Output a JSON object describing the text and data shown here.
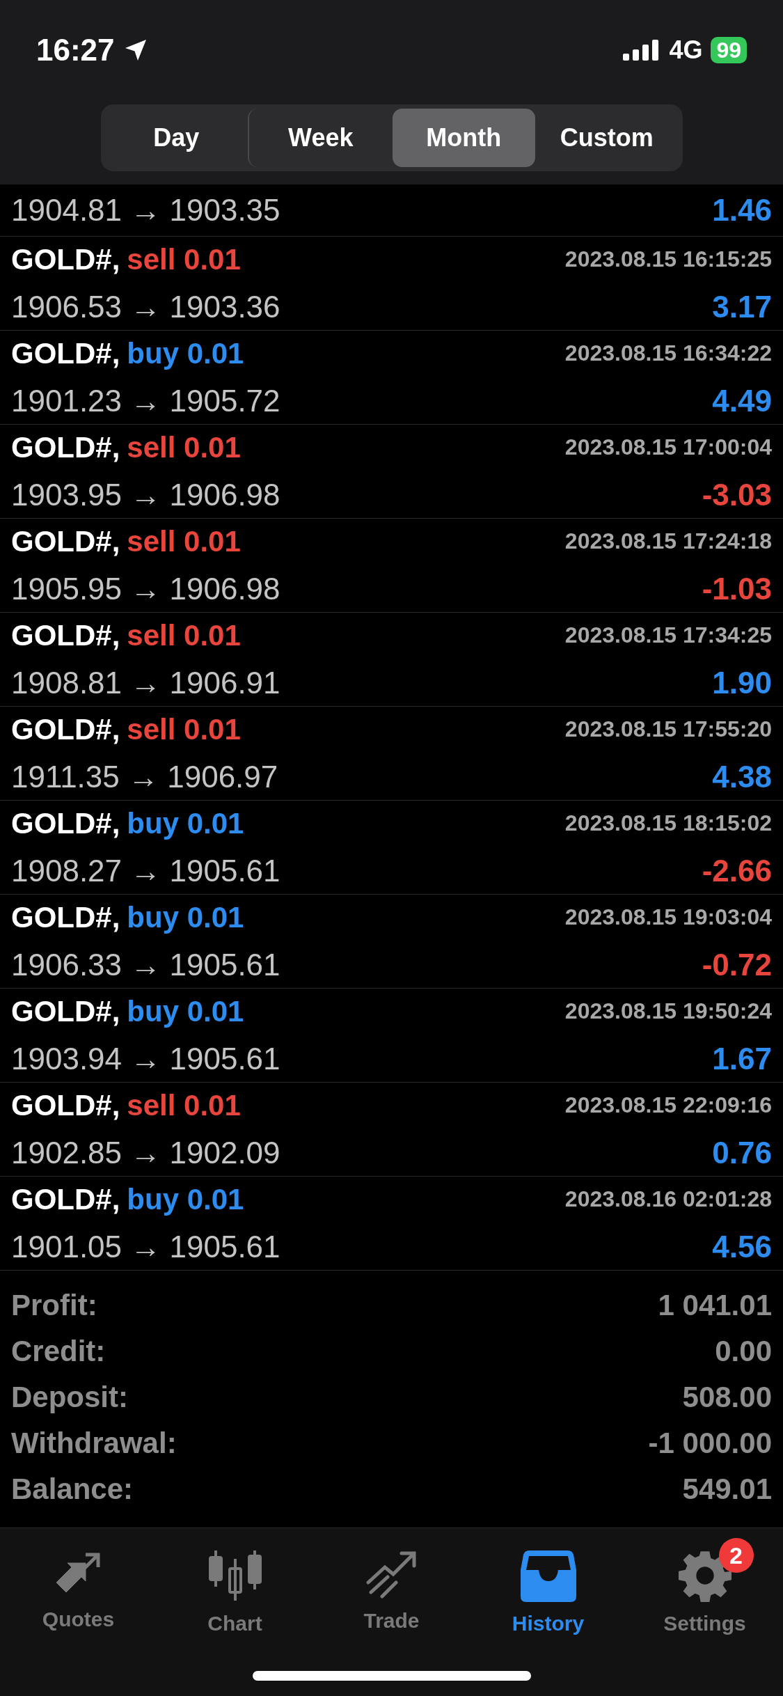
{
  "status_bar": {
    "time": "16:27",
    "network": "4G",
    "battery": "99"
  },
  "periods": [
    {
      "label": "Day",
      "selected": false
    },
    {
      "label": "Week",
      "selected": false
    },
    {
      "label": "Month",
      "selected": true
    },
    {
      "label": "Custom",
      "selected": false
    }
  ],
  "partial_trade": {
    "prices": "1904.81 → 1903.35",
    "profit": "1.46",
    "loss": false
  },
  "trades": [
    {
      "symbol": "GOLD#,",
      "kind": "sell",
      "order": "sell 0.01",
      "time": "2023.08.15 16:15:25",
      "prices": "1906.53 → 1903.36",
      "profit": "3.17",
      "loss": false
    },
    {
      "symbol": "GOLD#,",
      "kind": "buy",
      "order": "buy 0.01",
      "time": "2023.08.15 16:34:22",
      "prices": "1901.23 → 1905.72",
      "profit": "4.49",
      "loss": false
    },
    {
      "symbol": "GOLD#,",
      "kind": "sell",
      "order": "sell 0.01",
      "time": "2023.08.15 17:00:04",
      "prices": "1903.95 → 1906.98",
      "profit": "-3.03",
      "loss": true
    },
    {
      "symbol": "GOLD#,",
      "kind": "sell",
      "order": "sell 0.01",
      "time": "2023.08.15 17:24:18",
      "prices": "1905.95 → 1906.98",
      "profit": "-1.03",
      "loss": true
    },
    {
      "symbol": "GOLD#,",
      "kind": "sell",
      "order": "sell 0.01",
      "time": "2023.08.15 17:34:25",
      "prices": "1908.81 → 1906.91",
      "profit": "1.90",
      "loss": false
    },
    {
      "symbol": "GOLD#,",
      "kind": "sell",
      "order": "sell 0.01",
      "time": "2023.08.15 17:55:20",
      "prices": "1911.35 → 1906.97",
      "profit": "4.38",
      "loss": false
    },
    {
      "symbol": "GOLD#,",
      "kind": "buy",
      "order": "buy 0.01",
      "time": "2023.08.15 18:15:02",
      "prices": "1908.27 → 1905.61",
      "profit": "-2.66",
      "loss": true
    },
    {
      "symbol": "GOLD#,",
      "kind": "buy",
      "order": "buy 0.01",
      "time": "2023.08.15 19:03:04",
      "prices": "1906.33 → 1905.61",
      "profit": "-0.72",
      "loss": true
    },
    {
      "symbol": "GOLD#,",
      "kind": "buy",
      "order": "buy 0.01",
      "time": "2023.08.15 19:50:24",
      "prices": "1903.94 → 1905.61",
      "profit": "1.67",
      "loss": false
    },
    {
      "symbol": "GOLD#,",
      "kind": "sell",
      "order": "sell 0.01",
      "time": "2023.08.15 22:09:16",
      "prices": "1902.85 → 1902.09",
      "profit": "0.76",
      "loss": false
    },
    {
      "symbol": "GOLD#,",
      "kind": "buy",
      "order": "buy 0.01",
      "time": "2023.08.16 02:01:28",
      "prices": "1901.05 → 1905.61",
      "profit": "4.56",
      "loss": false
    }
  ],
  "summary": [
    {
      "label": "Profit:",
      "value": "1 041.01"
    },
    {
      "label": "Credit:",
      "value": "0.00"
    },
    {
      "label": "Deposit:",
      "value": "508.00"
    },
    {
      "label": "Withdrawal:",
      "value": "-1 000.00"
    },
    {
      "label": "Balance:",
      "value": "549.01"
    }
  ],
  "tab_bar": [
    {
      "label": "Quotes",
      "kind": "quotes",
      "selected": false
    },
    {
      "label": "Chart",
      "kind": "chart",
      "selected": false
    },
    {
      "label": "Trade",
      "kind": "trade",
      "selected": false
    },
    {
      "label": "History",
      "kind": "history",
      "selected": true
    },
    {
      "label": "Settings",
      "kind": "settings",
      "selected": false,
      "badge": "2"
    }
  ]
}
